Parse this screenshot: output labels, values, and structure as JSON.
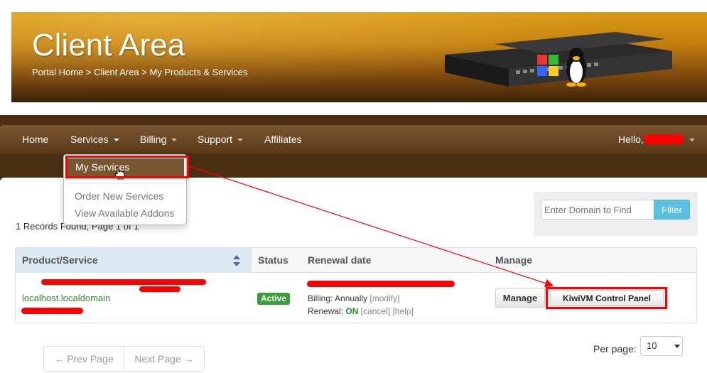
{
  "header": {
    "title": "Client Area",
    "breadcrumb": "Portal Home > Client Area > My Products & Services"
  },
  "nav": {
    "home": "Home",
    "services": "Services",
    "billing": "Billing",
    "support": "Support",
    "affiliates": "Affiliates",
    "hello": "Hello,"
  },
  "dropdown": {
    "my_services": "My Services",
    "order_new": "Order New Services",
    "view_addons": "View Available Addons"
  },
  "records": "1 Records Found, Page 1 of 1",
  "filter": {
    "placeholder": "Enter Domain to Find",
    "button": "Filter"
  },
  "table": {
    "headers": {
      "product": "Product/Service",
      "status": "Status",
      "renewal": "Renewal date",
      "manage": "Manage"
    },
    "row": {
      "hostname": "localhost.localdomain",
      "status": "Active",
      "billing_label": "Billing: Annually",
      "modify": "modify",
      "renewal_label": "Renewal:",
      "renewal_value": "ON",
      "cancel": "cancel",
      "help": "help",
      "manage_button": "Manage",
      "kiwi_button": "KiwiVM Control Panel"
    }
  },
  "pagination": {
    "prev": "← Prev Page",
    "next": "Next Page →",
    "per_page_label": "Per page:",
    "per_page_value": "10"
  },
  "colors": {
    "accent_brown": "#7a5630",
    "annotation_red": "#ff0000",
    "active_green": "#3a9d3a",
    "filter_blue": "#5bc0de"
  }
}
